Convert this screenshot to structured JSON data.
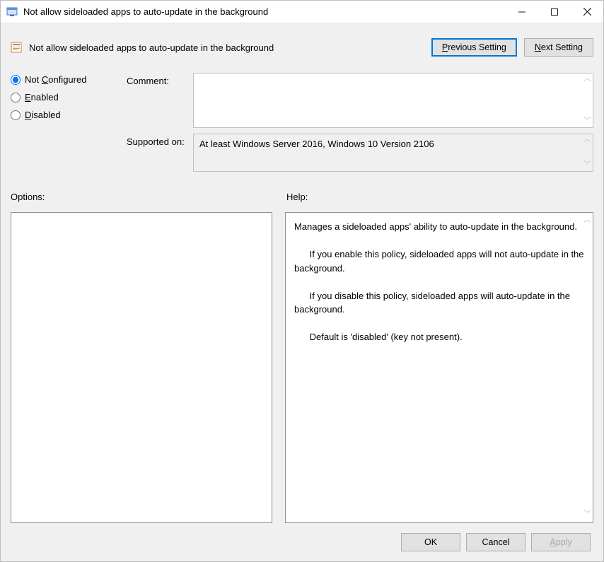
{
  "titlebar": {
    "title": "Not allow sideloaded apps to auto-update in the background"
  },
  "header": {
    "title": "Not allow sideloaded apps to auto-update in the background",
    "prev_label_pre": "",
    "prev_label_u": "P",
    "prev_label_post": "revious Setting",
    "next_label_pre": "",
    "next_label_u": "N",
    "next_label_post": "ext Setting"
  },
  "radios": {
    "not_configured_pre": "Not ",
    "not_configured_u": "C",
    "not_configured_post": "onfigured",
    "enabled_u": "E",
    "enabled_post": "nabled",
    "disabled_u": "D",
    "disabled_post": "isabled",
    "selected": "not_configured"
  },
  "labels": {
    "comment": "Comment:",
    "supported": "Supported on:",
    "options": "Options:",
    "help": "Help:"
  },
  "comment_text": "",
  "supported_text": "At least Windows Server 2016, Windows 10 Version 2106",
  "help_text": "Manages a sideloaded apps' ability to auto-update in the background.\n\n      If you enable this policy, sideloaded apps will not auto-update in the background.\n\n      If you disable this policy, sideloaded apps will auto-update in the background.\n\n      Default is 'disabled' (key not present).",
  "footer": {
    "ok": "OK",
    "cancel": "Cancel",
    "apply_u": "A",
    "apply_post": "pply"
  }
}
